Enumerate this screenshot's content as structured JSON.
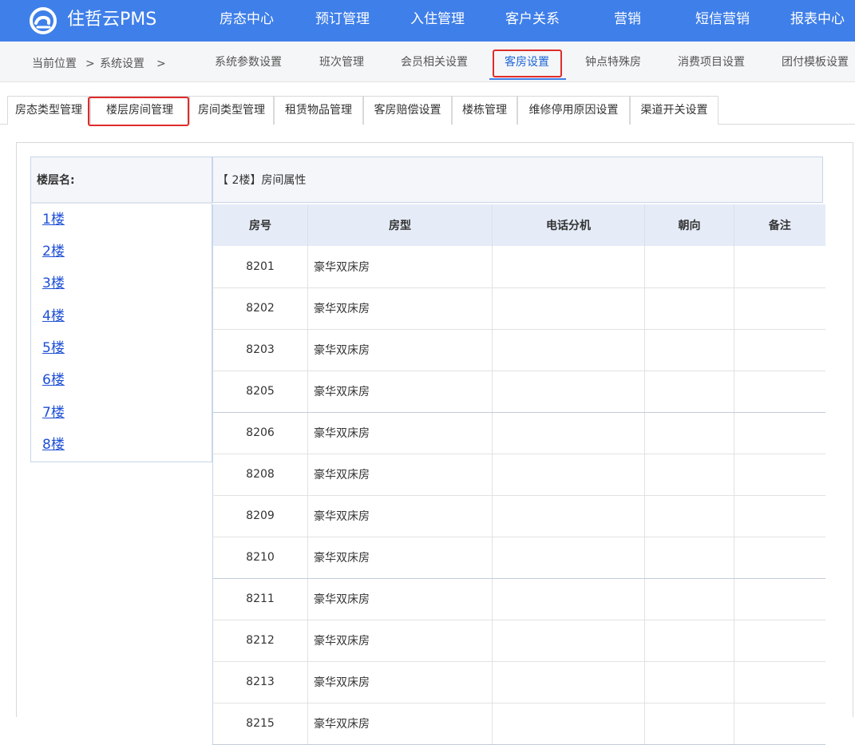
{
  "brand": {
    "name": "住哲云PMS",
    "icon": "cloud-logo-icon"
  },
  "topnav": [
    "房态中心",
    "预订管理",
    "入住管理",
    "客户关系",
    "营销",
    "短信营销",
    "报表中心"
  ],
  "breadcrumb": {
    "label": "当前位置",
    "sep1": ">",
    "item": "系统设置",
    "sep2": ">"
  },
  "subnav": [
    "系统参数设置",
    "班次管理",
    "会员相关设置",
    "客房设置",
    "钟点特殊房",
    "消费项目设置",
    "团付模板设置"
  ],
  "tabs": [
    "房态类型管理",
    "楼层房间管理",
    "房间类型管理",
    "租赁物品管理",
    "客房赔偿设置",
    "楼栋管理",
    "维修停用原因设置",
    "渠道开关设置"
  ],
  "floor_panel": {
    "header": "楼层名:",
    "floors": [
      "1楼",
      "2楼",
      "3楼",
      "4楼",
      "5楼",
      "6楼",
      "7楼",
      "8楼"
    ]
  },
  "room_panel": {
    "header": "【 2楼】房间属性",
    "columns": [
      "房号",
      "房型",
      "电话分机",
      "朝向",
      "备注"
    ],
    "rows": [
      [
        "8201",
        "豪华双床房",
        "",
        "",
        ""
      ],
      [
        "8202",
        "豪华双床房",
        "",
        "",
        ""
      ],
      [
        "8203",
        "豪华双床房",
        "",
        "",
        ""
      ],
      [
        "8205",
        "豪华双床房",
        "",
        "",
        ""
      ],
      [
        "8206",
        "豪华双床房",
        "",
        "",
        ""
      ],
      [
        "8208",
        "豪华双床房",
        "",
        "",
        ""
      ],
      [
        "8209",
        "豪华双床房",
        "",
        "",
        ""
      ],
      [
        "8210",
        "豪华双床房",
        "",
        "",
        ""
      ],
      [
        "8211",
        "豪华双床房",
        "",
        "",
        ""
      ],
      [
        "8212",
        "豪华双床房",
        "",
        "",
        ""
      ],
      [
        "8213",
        "豪华双床房",
        "",
        "",
        ""
      ],
      [
        "8215",
        "豪华双床房",
        "",
        "",
        ""
      ]
    ]
  },
  "colors": {
    "primary": "#3f7fe9",
    "highlight": "#e02b2b",
    "link": "#1e4fd6"
  }
}
